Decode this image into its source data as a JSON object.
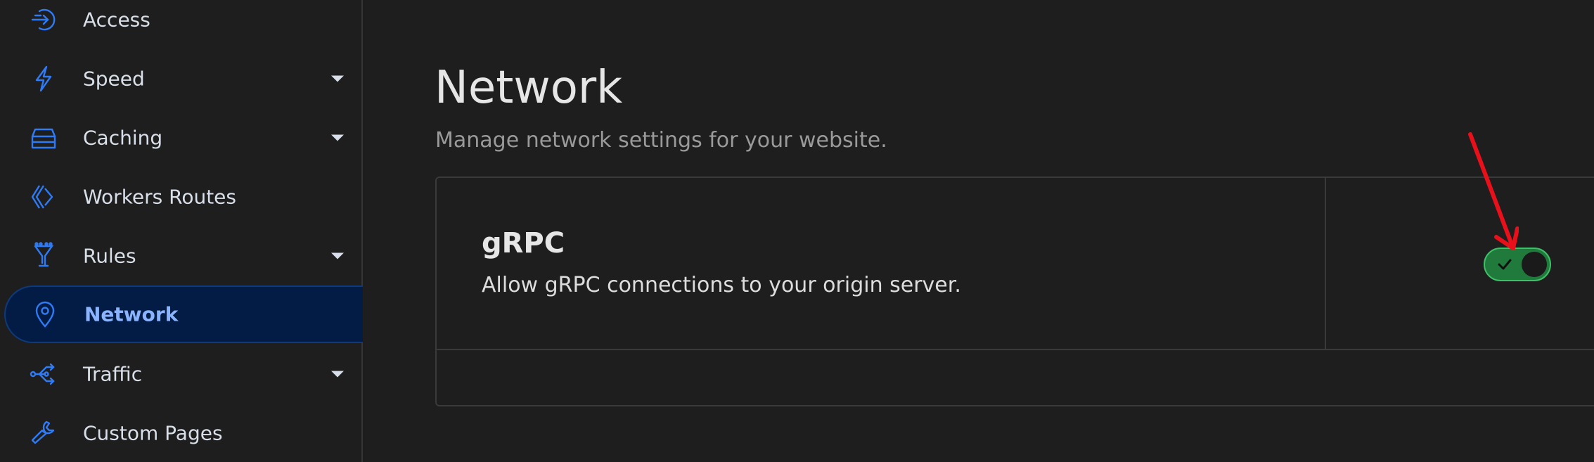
{
  "sidebar": {
    "items": [
      {
        "label": "Access",
        "icon": "access-icon",
        "has_caret": false,
        "active": false
      },
      {
        "label": "Speed",
        "icon": "lightning-icon",
        "has_caret": true,
        "active": false
      },
      {
        "label": "Caching",
        "icon": "server-stack-icon",
        "has_caret": true,
        "active": false
      },
      {
        "label": "Workers Routes",
        "icon": "workers-icon",
        "has_caret": false,
        "active": false
      },
      {
        "label": "Rules",
        "icon": "funnel-icon",
        "has_caret": true,
        "active": false
      },
      {
        "label": "Network",
        "icon": "location-pin-icon",
        "has_caret": false,
        "active": true
      },
      {
        "label": "Traffic",
        "icon": "traffic-icon",
        "has_caret": true,
        "active": false
      },
      {
        "label": "Custom Pages",
        "icon": "wrench-icon",
        "has_caret": false,
        "active": false
      }
    ]
  },
  "main": {
    "title": "Network",
    "subtitle": "Manage network settings for your website.",
    "setting": {
      "title": "gRPC",
      "description": "Allow gRPC connections to your origin server.",
      "enabled": true
    }
  },
  "colors": {
    "background": "#1e1e1e",
    "accent_blue": "#2f7bf5",
    "active_bg": "#021c45",
    "toggle_on": "#1f7a3c",
    "annotation_arrow": "#e8101a"
  }
}
